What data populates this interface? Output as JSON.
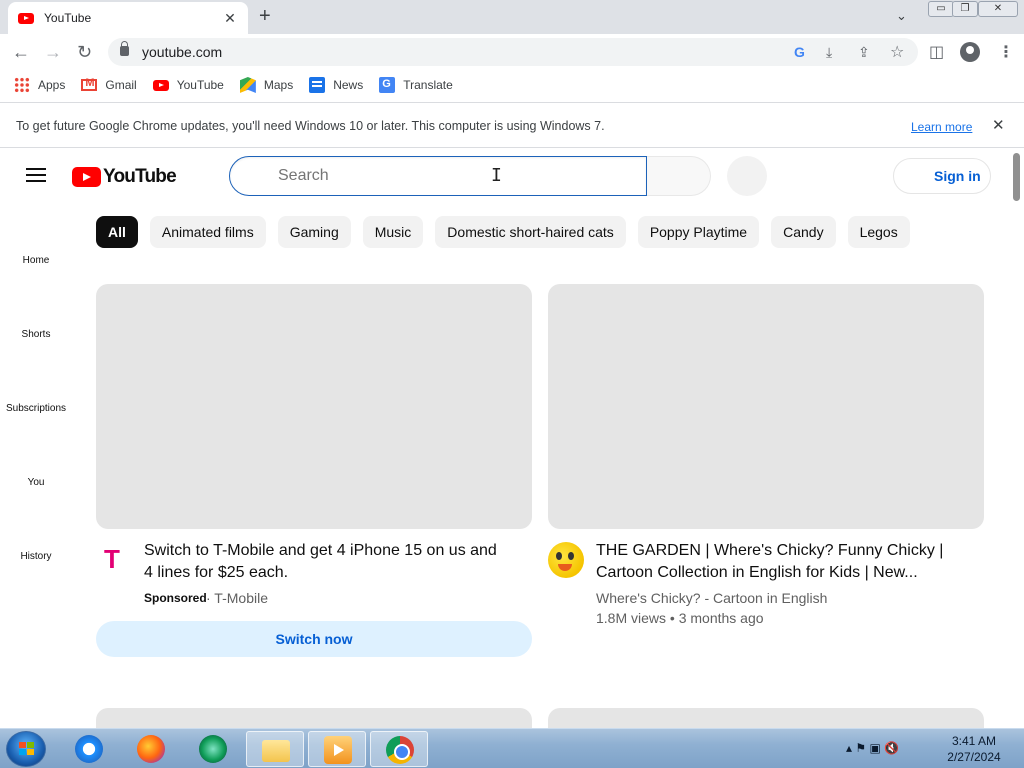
{
  "browser": {
    "tab_title": "YouTube",
    "tab_close": "✕",
    "new_tab": "+",
    "tab_search": "⌄",
    "window_controls": {
      "minimize": "▭",
      "restore": "❐",
      "close": "✕"
    },
    "nav": {
      "back": "←",
      "forward": "→",
      "reload": "↻"
    },
    "url": "youtube.com",
    "omnibox_icons": {
      "google": "G",
      "install": "⤓",
      "share": "⇪",
      "bookmark": "☆"
    },
    "toolbar_icons": {
      "side_panel": "◫",
      "menu": "⋮"
    },
    "bookmarks": [
      {
        "label": "Apps",
        "icon": "apps-icon"
      },
      {
        "label": "Gmail",
        "icon": "gmail-icon"
      },
      {
        "label": "YouTube",
        "icon": "youtube-icon"
      },
      {
        "label": "Maps",
        "icon": "maps-icon"
      },
      {
        "label": "News",
        "icon": "news-icon"
      },
      {
        "label": "Translate",
        "icon": "translate-icon"
      }
    ],
    "infobar": {
      "message": "To get future Google Chrome updates, you'll need Windows 10 or later. This computer is using Windows 7.",
      "link": "Learn more",
      "close": "✕"
    }
  },
  "youtube": {
    "logo_text": "YouTube",
    "search_placeholder": "Search",
    "sign_in": "Sign in",
    "chips": [
      "All",
      "Animated films",
      "Gaming",
      "Music",
      "Domestic short-haired cats",
      "Poppy Playtime",
      "Candy",
      "Legos"
    ],
    "guide": [
      "Home",
      "Shorts",
      "Subscriptions",
      "You",
      "History"
    ],
    "videos": [
      {
        "title_line1": "Switch to T-Mobile and get 4 iPhone 15 on us and",
        "title_line2": "4 lines for $25 each.",
        "sponsored": "Sponsored",
        "channel": "· T-Mobile",
        "cta": "Switch now",
        "avatar_text": "T"
      },
      {
        "title_line1": "THE GARDEN | Where's Chicky? Funny Chicky |",
        "title_line2": "Cartoon Collection in English for Kids | New...",
        "channel": "Where's Chicky? - Cartoon in English",
        "stats": "1.8M views • 3 months ago"
      }
    ]
  },
  "taskbar": {
    "tray_icons": "▴  ⚑  ▣  🔇",
    "time": "3:41 AM",
    "date": "2/27/2024"
  },
  "colors": {
    "yt_red": "#ff0000",
    "link_blue": "#065fd4",
    "tmobile_magenta": "#e20074"
  }
}
